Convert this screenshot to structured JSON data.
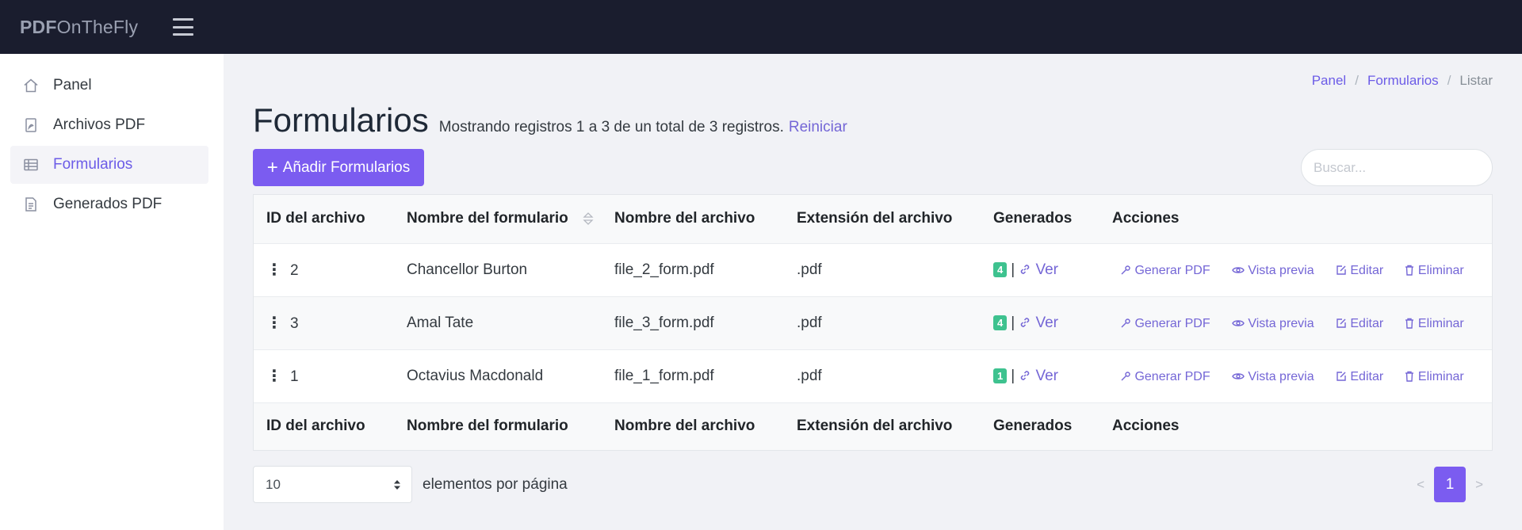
{
  "header": {
    "brand_bold": "PDF",
    "brand_rest": "OnTheFly"
  },
  "sidebar": {
    "items": [
      {
        "label": "Panel",
        "icon": "home-icon",
        "active": false
      },
      {
        "label": "Archivos PDF",
        "icon": "pdf-file-icon",
        "active": false
      },
      {
        "label": "Formularios",
        "icon": "table-icon",
        "active": true
      },
      {
        "label": "Generados PDF",
        "icon": "document-icon",
        "active": false
      }
    ]
  },
  "breadcrumb": {
    "items": [
      "Panel",
      "Formularios",
      "Listar"
    ],
    "separator": "/"
  },
  "page": {
    "title": "Formularios",
    "records_text": "Mostrando registros 1 a 3 de un total de 3 registros.",
    "reset_label": "Reiniciar",
    "add_label": "Añadir Formularios",
    "search_placeholder": "Buscar..."
  },
  "table": {
    "columns": [
      "ID del archivo",
      "Nombre del formulario",
      "Nombre del archivo",
      "Extensión del archivo",
      "Generados",
      "Acciones"
    ],
    "rows": [
      {
        "id": "2",
        "form_name": "Chancellor Burton",
        "file_name": "file_2_form.pdf",
        "ext": ".pdf",
        "generated": "4"
      },
      {
        "id": "3",
        "form_name": "Amal Tate",
        "file_name": "file_3_form.pdf",
        "ext": ".pdf",
        "generated": "4"
      },
      {
        "id": "1",
        "form_name": "Octavius Macdonald",
        "file_name": "file_1_form.pdf",
        "ext": ".pdf",
        "generated": "1"
      }
    ],
    "view_label": "Ver",
    "pipe": "|",
    "actions": {
      "generate": "Generar PDF",
      "preview": "Vista previa",
      "edit": "Editar",
      "delete": "Eliminar"
    }
  },
  "pagination": {
    "per_page_value": "10",
    "per_page_label": "elementos por página",
    "prev": "<",
    "current": "1",
    "next": ">"
  },
  "colors": {
    "accent": "#7b5cf0",
    "badge": "#3ec28f",
    "topbar": "#1a1d2e"
  }
}
